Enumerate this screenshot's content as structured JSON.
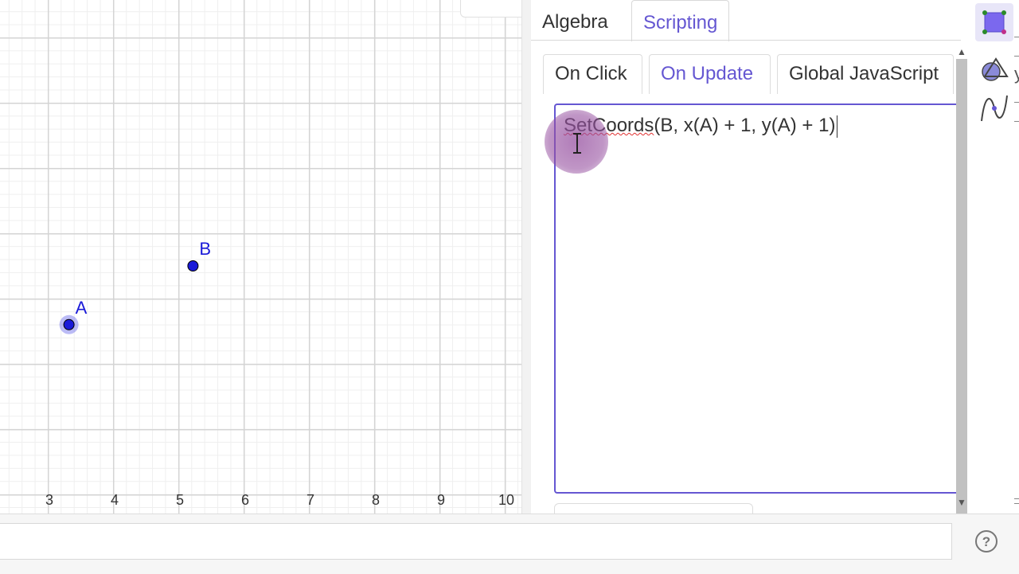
{
  "graphics": {
    "x_axis_ticks": [
      "3",
      "4",
      "5",
      "6",
      "7",
      "8",
      "9",
      "10"
    ],
    "points": [
      {
        "label": "A",
        "x": 3.3,
        "y": -0.4,
        "selected": true
      },
      {
        "label": "B",
        "x": 5.2,
        "y": 0.5,
        "selected": false
      }
    ],
    "point_color": "#1a1ad8"
  },
  "panel": {
    "tabs": [
      {
        "label": "Algebra",
        "active": false
      },
      {
        "label": "Scripting",
        "active": true
      }
    ],
    "script_tabs": [
      {
        "label": "On Click",
        "active": false
      },
      {
        "label": "On Update",
        "active": true
      },
      {
        "label": "Global JavaScript",
        "active": false
      }
    ],
    "script_code_error_part": "SetCoords",
    "script_code_rest": "(B, x(A) + 1, y(A) + 1)",
    "accent_color": "#6557d2"
  },
  "toolbar": {
    "tools": [
      "move-tool-icon",
      "shapes-tool-icon",
      "curve-tool-icon"
    ]
  },
  "input_bar": {
    "value": "",
    "help_icon": "help-icon"
  }
}
